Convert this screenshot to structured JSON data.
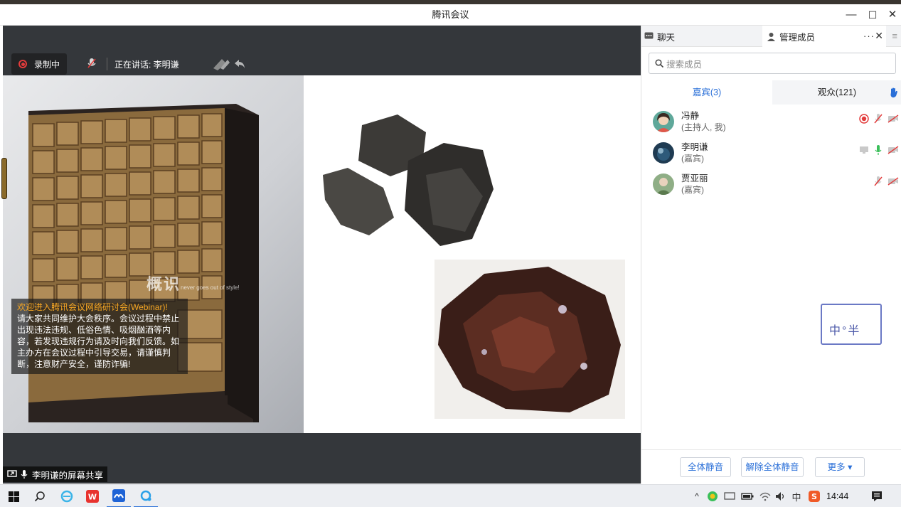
{
  "window": {
    "title": "腾讯会议",
    "controls": {
      "minimize": "—",
      "maximize": "☐",
      "close": "✕"
    }
  },
  "stage": {
    "recording_label": "录制中",
    "speaking_label": "正在讲话: 李明谦",
    "watermark": "概识",
    "watermark_sub": "never goes out of style!",
    "notice_title": "欢迎进入腾讯会议网络研讨会(Webinar)!",
    "notice_body": "请大家共同维护大会秩序。会议过程中禁止出现违法违规、低俗色情、吸烟酗酒等内容，若发现违规行为请及时向我们反馈。如主办方在会议过程中引导交易，请谨慎判断，注意财产安全，谨防诈骗!",
    "share_label": "李明谦的屏幕共享"
  },
  "panel": {
    "tab_chat": "聊天",
    "tab_members": "管理成员",
    "tab_more": "···",
    "tab_close": "✕",
    "menu": "≡",
    "search_placeholder": "搜索成员",
    "subtab_guests": "嘉宾(3)",
    "subtab_audience": "观众(121)",
    "members": [
      {
        "name": "冯静",
        "role": "(主持人, 我)"
      },
      {
        "name": "李明谦",
        "role": "(嘉宾)"
      },
      {
        "name": "贾亚丽",
        "role": "(嘉宾)"
      }
    ],
    "buttons": {
      "mute_all": "全体静音",
      "unmute_all": "解除全体静音",
      "more": "更多 ▾"
    }
  },
  "ime": {
    "text": "中°半"
  },
  "taskbar": {
    "clock": "14:44",
    "tray_ime": "中"
  },
  "colors": {
    "accent_blue": "#2a6fd8",
    "record_red": "#e23b3b",
    "notice_orange": "#f6a623"
  }
}
